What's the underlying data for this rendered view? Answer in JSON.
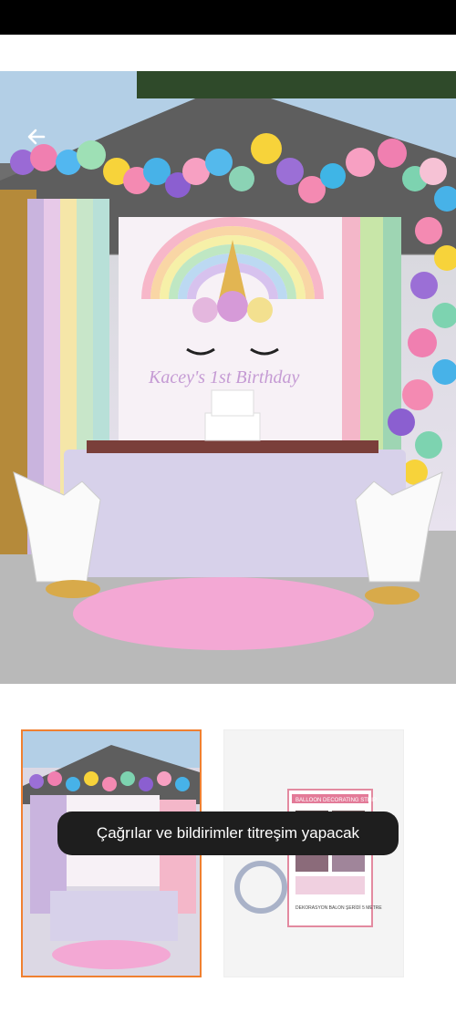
{
  "toast": {
    "text": "Çağrılar ve bildirimler titreşim yapacak"
  },
  "hero": {
    "banner_text": "Kacey's 1st Birthday"
  },
  "thumbnails": [
    {
      "name": "unicorn-party-photo",
      "selected": true
    },
    {
      "name": "balloon-decorating-strip-product",
      "selected": false,
      "label": "BALLOON DECORATING STRIP",
      "caption": "DEKORASYON BALON ŞERİDİ 5 METRE"
    }
  ],
  "colors": {
    "accent": "#f08030",
    "toast_bg": "#1e1e1e"
  }
}
